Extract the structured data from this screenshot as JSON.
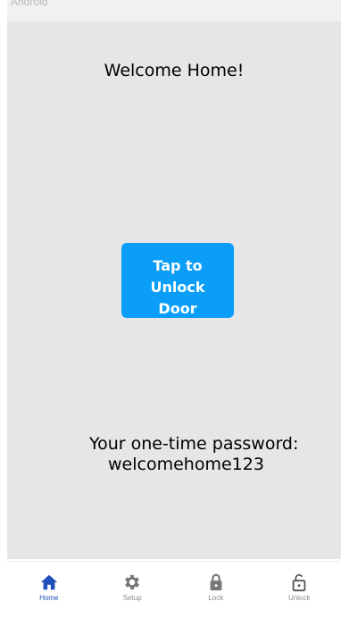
{
  "topbar": {
    "label": "Android"
  },
  "screen": {
    "title": "Welcome Home!",
    "unlock_button": {
      "label": "Tap to Unlock Door",
      "color": "#0a9ef8"
    },
    "password": {
      "label": "Your one-time password:",
      "value": "welcomehome123"
    }
  },
  "bottom_nav": {
    "active_color": "#1f4fb9",
    "inactive_color": "#777777",
    "items": [
      {
        "label": "Home",
        "icon": "home-icon",
        "active": true
      },
      {
        "label": "Setup",
        "icon": "gear-icon",
        "active": false
      },
      {
        "label": "Lock",
        "icon": "lock-icon",
        "active": false
      },
      {
        "label": "Unlock",
        "icon": "unlock-icon",
        "active": false
      }
    ]
  }
}
